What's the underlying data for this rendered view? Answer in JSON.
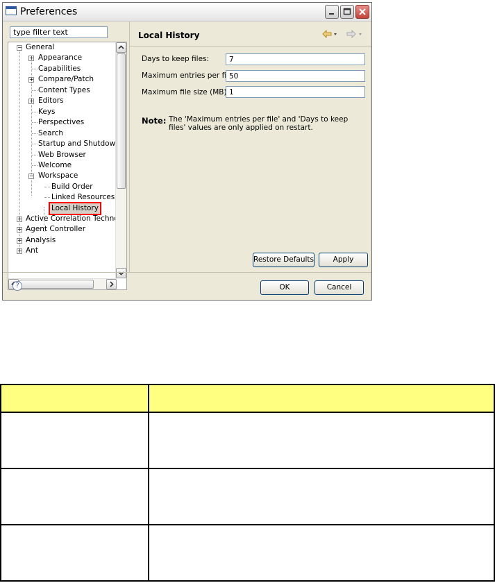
{
  "window": {
    "title": "Preferences"
  },
  "filter": {
    "placeholder": "type filter text"
  },
  "tree": {
    "items": [
      {
        "label": "General",
        "expander": "minus"
      },
      {
        "label": "Appearance",
        "expander": "plus"
      },
      {
        "label": "Capabilities",
        "expander": ""
      },
      {
        "label": "Compare/Patch",
        "expander": "plus"
      },
      {
        "label": "Content Types",
        "expander": ""
      },
      {
        "label": "Editors",
        "expander": "plus"
      },
      {
        "label": "Keys",
        "expander": ""
      },
      {
        "label": "Perspectives",
        "expander": ""
      },
      {
        "label": "Search",
        "expander": ""
      },
      {
        "label": "Startup and Shutdown",
        "expander": ""
      },
      {
        "label": "Web Browser",
        "expander": ""
      },
      {
        "label": "Welcome",
        "expander": ""
      },
      {
        "label": "Workspace",
        "expander": "minus"
      },
      {
        "label": "Build Order",
        "expander": ""
      },
      {
        "label": "Linked Resources",
        "expander": ""
      },
      {
        "label": "Local History",
        "expander": "",
        "selected": true
      },
      {
        "label": "Active Correlation Technolo",
        "expander": "plus"
      },
      {
        "label": "Agent Controller",
        "expander": "plus"
      },
      {
        "label": "Analysis",
        "expander": "plus"
      },
      {
        "label": "Ant",
        "expander": "plus"
      }
    ]
  },
  "page": {
    "title": "Local History",
    "fields": [
      {
        "label": "Days to keep files:",
        "value": "7"
      },
      {
        "label": "Maximum entries per file:",
        "value": "50"
      },
      {
        "label": "Maximum file size (MB):",
        "value": "1"
      }
    ],
    "note_label": "Note:",
    "note_text": "The 'Maximum entries per file' and 'Days to keep files' values are only applied on restart.",
    "restore_label": "Restore Defaults",
    "apply_label": "Apply"
  },
  "dialog": {
    "ok_label": "OK",
    "cancel_label": "Cancel",
    "help_symbol": "?"
  },
  "icons": {
    "back": "back-arrow-icon",
    "forward": "forward-arrow-icon",
    "help": "help-icon"
  },
  "colors": {
    "highlight": "#ff0000",
    "table_header": "#ffff80",
    "window_bg": "#ece9d8"
  }
}
